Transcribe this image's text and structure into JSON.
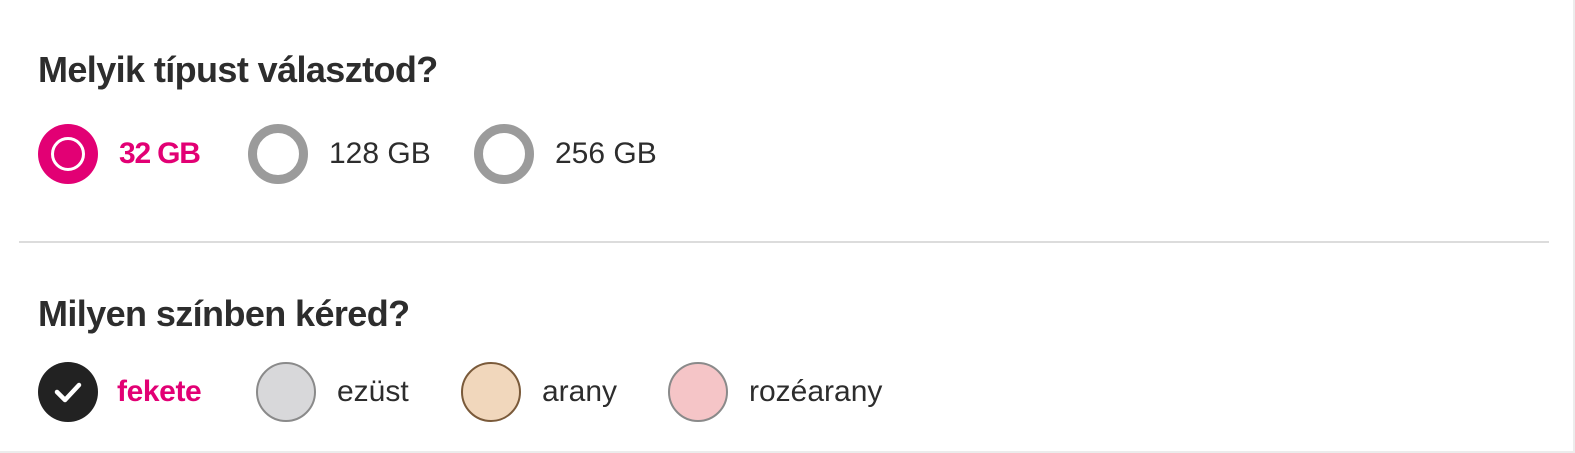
{
  "storage_section": {
    "title": "Melyik típust választod?",
    "options": [
      {
        "label": "32 GB",
        "selected": true
      },
      {
        "label": "128 GB",
        "selected": false
      },
      {
        "label": "256 GB",
        "selected": false
      }
    ]
  },
  "color_section": {
    "title": "Milyen színben kéred?",
    "options": [
      {
        "label": "fekete",
        "color": "#222222",
        "selected": true
      },
      {
        "label": "ezüst",
        "color": "#d8d8da",
        "selected": false
      },
      {
        "label": "arany",
        "color": "#f1d7bc",
        "selected": false
      },
      {
        "label": "rozéarany",
        "color": "#f5c5c7",
        "selected": false
      }
    ]
  },
  "accent_color": "#e20074"
}
